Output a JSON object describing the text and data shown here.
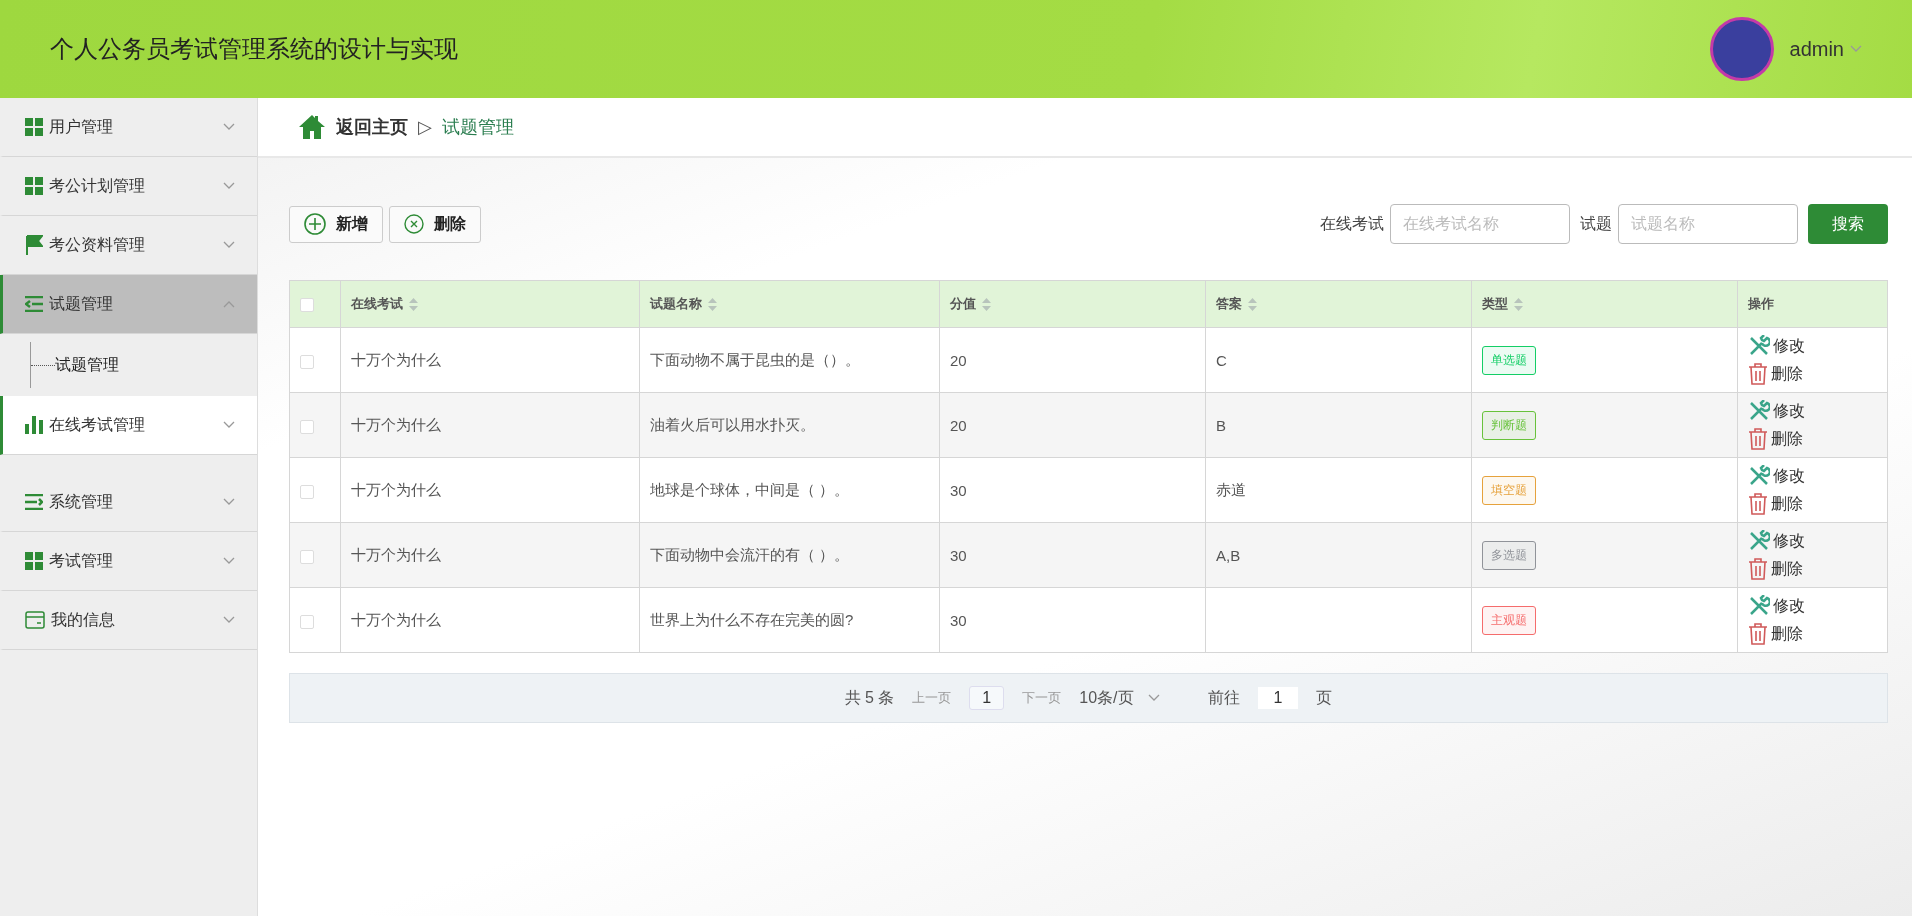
{
  "header": {
    "title": "个人公务员考试管理系统的设计与实现",
    "user": "admin"
  },
  "sidebar": {
    "items": [
      {
        "label": "用户管理",
        "expanded": false,
        "active": false,
        "highlighted": false
      },
      {
        "label": "考公计划管理",
        "expanded": false,
        "active": false,
        "highlighted": false
      },
      {
        "label": "考公资料管理",
        "expanded": false,
        "active": false,
        "highlighted": false
      },
      {
        "label": "试题管理",
        "expanded": true,
        "active": true,
        "highlighted": false,
        "children": [
          {
            "label": "试题管理"
          }
        ]
      },
      {
        "label": "在线考试管理",
        "expanded": false,
        "active": false,
        "highlighted": true
      },
      {
        "label": "系统管理",
        "expanded": false,
        "active": false,
        "highlighted": false
      },
      {
        "label": "考试管理",
        "expanded": false,
        "active": false,
        "highlighted": false
      },
      {
        "label": "我的信息",
        "expanded": false,
        "active": false,
        "highlighted": false
      }
    ]
  },
  "breadcrumb": {
    "home": "返回主页",
    "separator": "▷",
    "current": "试题管理"
  },
  "toolbar": {
    "buttons": [
      {
        "kind": "add",
        "label": "新增"
      },
      {
        "kind": "delete",
        "label": "删除"
      }
    ],
    "filters": [
      {
        "label": "在线考试",
        "placeholder": "在线考试名称"
      },
      {
        "label": "试题",
        "placeholder": "试题名称"
      }
    ],
    "search": "搜索"
  },
  "table": {
    "select_all": {
      "checked": false
    },
    "columns": [
      {
        "label": "在线考试",
        "sortable": true
      },
      {
        "label": "试题名称",
        "sortable": true
      },
      {
        "label": "分值",
        "sortable": true
      },
      {
        "label": "答案",
        "sortable": true
      },
      {
        "label": "类型",
        "sortable": true
      },
      {
        "label": "操作",
        "sortable": false
      }
    ],
    "rows": [
      {
        "checked": false,
        "exam": "十万个为什么",
        "question": "下面动物不属于昆虫的是（）。",
        "score": "20",
        "answer": "C",
        "type": "单选题",
        "color": "#13ce66",
        "actions": [
          "修改",
          "删除"
        ]
      },
      {
        "checked": false,
        "exam": "十万个为什么",
        "question": "油着火后可以用水扑灭。",
        "score": "20",
        "answer": "B",
        "type": "判断题",
        "color": "#67c23a",
        "actions": [
          "修改",
          "删除"
        ]
      },
      {
        "checked": false,
        "exam": "十万个为什么",
        "question": "地球是个球体，中间是（ ）。",
        "score": "30",
        "answer": "赤道",
        "type": "填空题",
        "color": "#e6a23c",
        "actions": [
          "修改",
          "删除"
        ]
      },
      {
        "checked": false,
        "exam": "十万个为什么",
        "question": "下面动物中会流汗的有（ ）。",
        "score": "30",
        "answer": "A,B",
        "type": "多选题",
        "color": "#909399",
        "actions": [
          "修改",
          "删除"
        ]
      },
      {
        "checked": false,
        "exam": "十万个为什么",
        "question": "世界上为什么不存在完美的圆?",
        "score": "30",
        "answer": "",
        "type": "主观题",
        "color": "#f56c6c",
        "actions": [
          "修改",
          "删除"
        ]
      }
    ]
  },
  "pagination": {
    "total": "共 5 条",
    "prev": "上一页",
    "page": "1",
    "next": "下一页",
    "size": "10条/页",
    "goto": "前往",
    "goto_value": "1",
    "goto_suffix": "页"
  }
}
